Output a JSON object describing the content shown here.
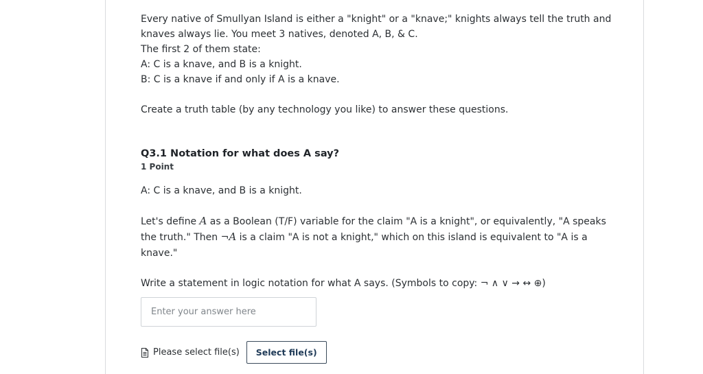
{
  "intro": {
    "line1": "Every native of Smullyan Island is either a \"knight\" or a \"knave;\" knights always tell the truth and",
    "line2": "knaves always lie. You meet 3 natives, denoted A, B, & C.",
    "line3": "The first 2 of them state:",
    "line4": "A: C is a knave, and B is a knight.",
    "line5": "B: C is a knave if and only if A is a knave.",
    "line6": "Create a truth table (by any technology you like) to answer these questions."
  },
  "question": {
    "title": "Q3.1 Notation for what does A say?",
    "points": "1 Point",
    "statement": "A: C is a knave, and B is a knight.",
    "def_p1": "Let's define ",
    "def_var1": "A",
    "def_p2": " as a Boolean (T/F) variable for the claim \"A is a knight\", or equivalently, \"A speaks",
    "def_p3": "the truth.\" Then ",
    "def_neg": "¬",
    "def_var2": "A",
    "def_p4": " is a claim \"A is not a knight,\" which on this island is equivalent to \"A is a",
    "def_p5": "knave.\"",
    "prompt": "Write a statement in logic notation for what A says. (Symbols to copy: ¬ ∧ ∨ → ↔ ⊕)"
  },
  "answer": {
    "placeholder": "Enter your answer here",
    "value": ""
  },
  "upload": {
    "label": "Please select file(s)",
    "button": "Select file(s)"
  }
}
